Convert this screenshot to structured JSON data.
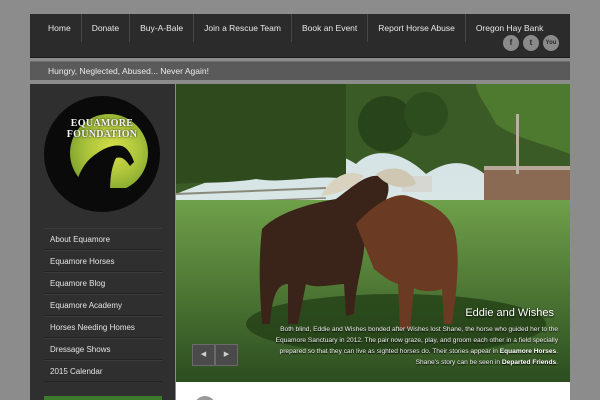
{
  "nav": {
    "items": [
      "Home",
      "Donate",
      "Buy-A-Bale",
      "Join a Rescue Team",
      "Book an Event",
      "Report Horse Abuse",
      "Oregon Hay Bank"
    ]
  },
  "social": {
    "facebook": "f",
    "twitter": "t",
    "youtube": "You"
  },
  "tagline": "Hungry, Neglected, Abused... Never Again!",
  "logo": {
    "line1": "EQUAMORE",
    "line2": "FOUNDATION"
  },
  "sidebar": {
    "items": [
      "About Equamore",
      "Equamore Horses",
      "Equamore Blog",
      "Equamore Academy",
      "Horses Needing Homes",
      "Dressage Shows",
      "2015 Calendar"
    ]
  },
  "slide": {
    "title": "Eddie and Wishes",
    "text_before_1": "Both blind, Eddie and Wishes bonded after Wishes lost Shane, the horse who guided her to the Equamore Sanctuary in 2012. The pair now graze, play, and groom each other in a field specially prepared so that they can live as sighted horses do. Their stories appear in ",
    "link1": "Equamore Horses",
    "text_between": ". Shane's story can be seen in ",
    "link2": "Departed Friends",
    "text_after": "."
  },
  "slider_controls": {
    "prev": "◀",
    "next": "▶"
  },
  "colors": {
    "page_bg": "#8c8c8c",
    "nav_bg": "#2b2b2b",
    "sidebar_bg": "#2f2f2f",
    "tagline_bg": "#5a5a5a"
  }
}
